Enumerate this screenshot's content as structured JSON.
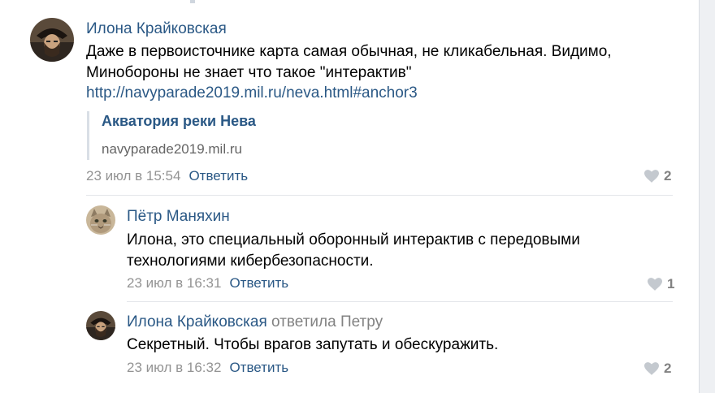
{
  "comments": [
    {
      "author": "Илона Крайковская",
      "text": "Даже в первоисточнике карта самая обычная, не кликабельная. Видимо, Минобороны не знает что такое \"интерактив\"",
      "link": "http://navyparade2019.mil.ru/neva.html#anchor3",
      "attachment": {
        "title": "Акватория реки Нева",
        "domain": "navyparade2019.mil.ru"
      },
      "date": "23 июл в 15:54",
      "reply_label": "Ответить",
      "likes": "2"
    },
    {
      "author": "Пётр Маняхин",
      "text": "Илона, это специальный оборонный интерактив с передовыми технологиями кибербезопасности.",
      "date": "23 июл в 16:31",
      "reply_label": "Ответить",
      "likes": "1"
    },
    {
      "author": "Илона Крайковская",
      "reply_to": "ответила Петру",
      "text": "Секретный. Чтобы врагов запутать и обескуражить.",
      "date": "23 июл в 16:32",
      "reply_label": "Ответить",
      "likes": "2"
    }
  ],
  "colors": {
    "link": "#2a5885",
    "muted": "#939393",
    "divider": "#e4e6ea"
  }
}
